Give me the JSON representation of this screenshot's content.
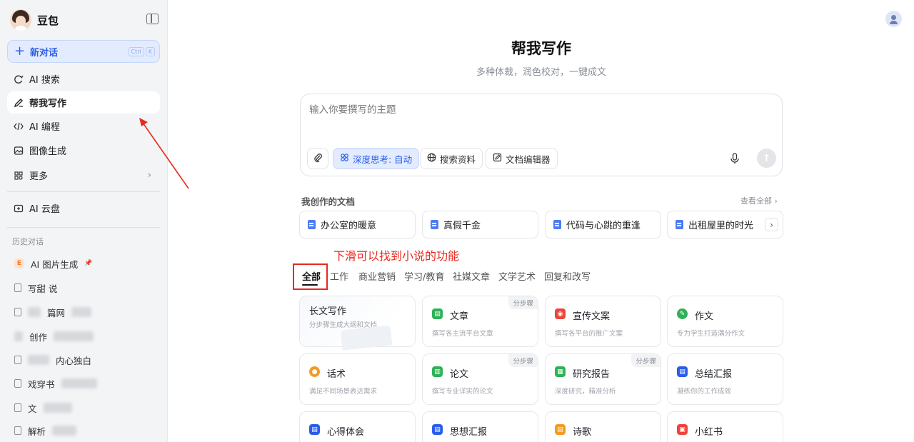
{
  "brand": {
    "name": "豆包"
  },
  "sidebar": {
    "new_chat": {
      "label": "新对话",
      "shortcut": [
        "Ctrl",
        "K"
      ]
    },
    "items": [
      {
        "label": "AI 搜索",
        "icon": "search-refresh-icon"
      },
      {
        "label": "帮我写作",
        "icon": "pen-icon",
        "active": true
      },
      {
        "label": "AI 编程",
        "icon": "code-icon"
      },
      {
        "label": "图像生成",
        "icon": "image-icon"
      },
      {
        "label": "更多",
        "icon": "grid-icon"
      }
    ],
    "cloud": {
      "label": "AI 云盘",
      "icon": "cloud-drive-icon"
    },
    "history_title": "历史对话",
    "history": [
      {
        "label": "AI 图片生成",
        "pinned": true
      },
      {
        "label": "写甜 说"
      },
      {
        "label": "篇网 "
      },
      {
        "label": "创作 "
      },
      {
        "label": "内心独白"
      },
      {
        "label": "戏穿书 "
      },
      {
        "label": "文 "
      },
      {
        "label": "解析 "
      }
    ]
  },
  "main": {
    "title": "帮我写作",
    "subtitle": "多种体裁，润色校对，一键成文",
    "input_placeholder": "输入你要撰写的主题",
    "tools": {
      "deep_think": "深度思考: 自动",
      "search": "搜索资料",
      "editor": "文档编辑器"
    },
    "docs_title": "我创作的文档",
    "docs_more": "查看全部",
    "docs": [
      "办公室的暖意",
      "真假千金",
      "代码与心跳的重逢",
      "出租屋里的时光"
    ],
    "annotation": "下滑可以找到小说的功能",
    "categories": [
      "全部",
      "工作",
      "商业营销",
      "学习/教育",
      "社媒文章",
      "文学艺术",
      "回复和改写"
    ],
    "step_tag": "分步骤",
    "cards": [
      {
        "title": "长文写作",
        "desc": "分步骤生成大纲和文档",
        "color": "",
        "step": false
      },
      {
        "title": "文章",
        "desc": "撰写各主流平台文章",
        "color": "#2fb157",
        "step": true
      },
      {
        "title": "宣传文案",
        "desc": "撰写各平台的推广文案",
        "color": "#f0433a",
        "step": false
      },
      {
        "title": "作文",
        "desc": "专为学生打造满分作文",
        "color": "#2fb157",
        "step": false
      },
      {
        "title": "话术",
        "desc": "满足不同场景表达需求",
        "color": "#f59a23",
        "step": false
      },
      {
        "title": "论文",
        "desc": "撰写专业详实的论文",
        "color": "#2fb157",
        "step": true
      },
      {
        "title": "研究报告",
        "desc": "深度研究，精准分析",
        "color": "#2fb157",
        "step": true
      },
      {
        "title": "总结汇报",
        "desc": "凝练你的工作成效",
        "color": "#2a5ee8",
        "step": false
      },
      {
        "title": "心得体会",
        "desc": "",
        "color": "#2a5ee8",
        "step": false
      },
      {
        "title": "思想汇报",
        "desc": "",
        "color": "#2a5ee8",
        "step": false
      },
      {
        "title": "诗歌",
        "desc": "",
        "color": "#f59a23",
        "step": false
      },
      {
        "title": "小红书",
        "desc": "",
        "color": "#f0433a",
        "step": false
      }
    ]
  },
  "colors": {
    "accent": "#2a5ee8",
    "annotation": "#e62a1f"
  }
}
